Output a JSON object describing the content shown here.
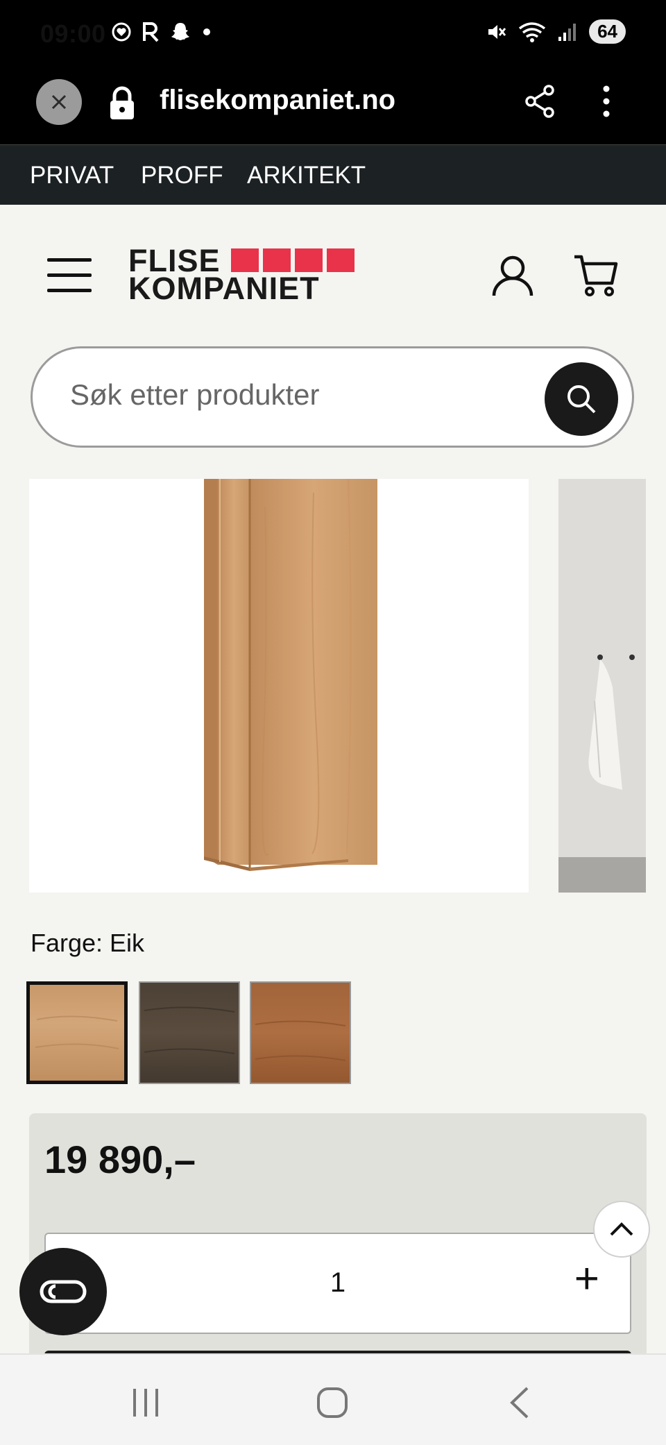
{
  "status_bar": {
    "time": "09:00",
    "battery": "64",
    "left_icons": [
      "heart-circle-icon",
      "r-icon",
      "snapchat-icon",
      "dot-icon"
    ],
    "right_icons": [
      "mute-icon",
      "wifi-icon",
      "signal-icon"
    ]
  },
  "browser": {
    "url": "flisekompaniet.no",
    "icons": [
      "close-icon",
      "lock-icon",
      "share-icon",
      "kebab-menu-icon"
    ]
  },
  "segment_nav": {
    "items": [
      "PRIVAT",
      "PROFF",
      "ARKITEKT"
    ]
  },
  "header": {
    "logo_line1": "FLISE",
    "logo_line2": "KOMPANIET",
    "logo_registered": "®",
    "brand_color": "#e8334a",
    "icons": [
      "menu-icon",
      "user-icon",
      "cart-icon"
    ]
  },
  "search": {
    "placeholder": "Søk etter produkter"
  },
  "product": {
    "color_label": "Farge: Eik",
    "swatches": [
      {
        "name": "Eik",
        "color": "#c89b6d",
        "selected": true
      },
      {
        "name": "dark",
        "color": "#4a3f34",
        "selected": false
      },
      {
        "name": "walnut",
        "color": "#9c5e33",
        "selected": false
      }
    ],
    "price": "19 890,–",
    "quantity": "1",
    "plus_symbol": "+"
  },
  "colors": {
    "status_bg": "#000000",
    "segment_bg": "#1c2124",
    "page_bg": "#f4f4f1",
    "price_box_bg": "#e1e1dc"
  }
}
